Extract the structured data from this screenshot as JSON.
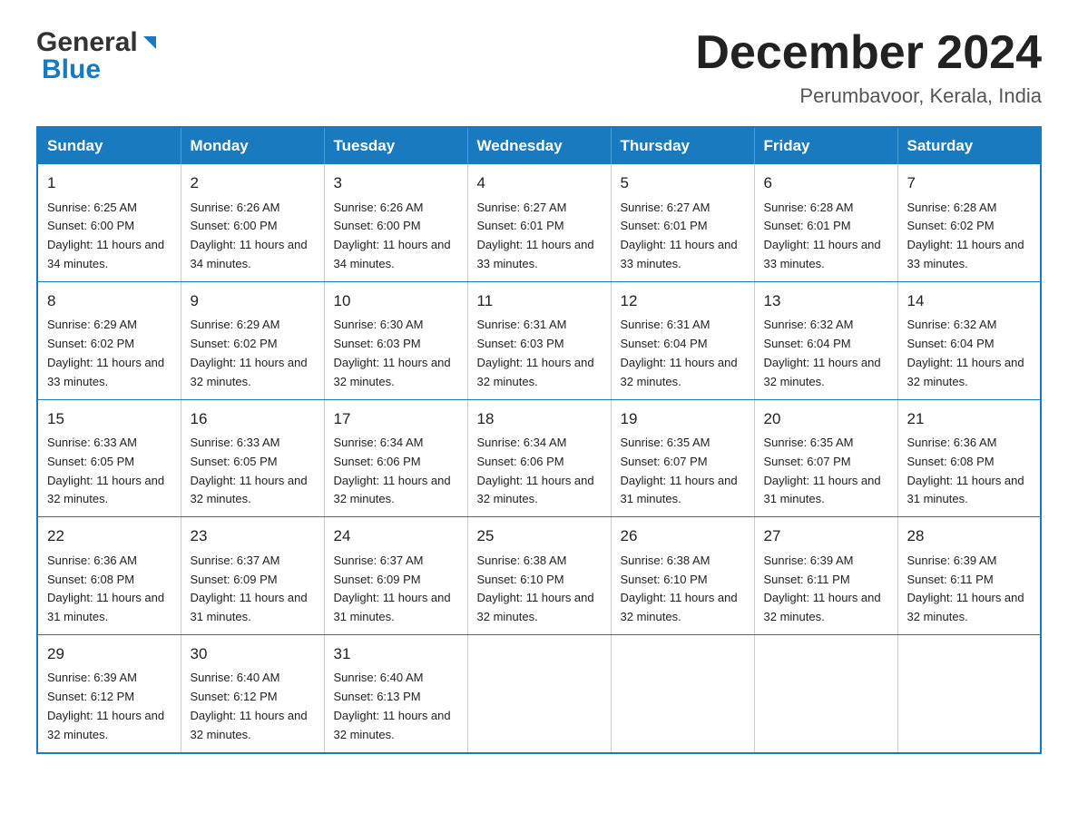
{
  "logo": {
    "general": "General",
    "blue": "Blue"
  },
  "title": "December 2024",
  "location": "Perumbavoor, Kerala, India",
  "days_of_week": [
    "Sunday",
    "Monday",
    "Tuesday",
    "Wednesday",
    "Thursday",
    "Friday",
    "Saturday"
  ],
  "weeks": [
    [
      {
        "day": "1",
        "sunrise": "6:25 AM",
        "sunset": "6:00 PM",
        "daylight": "11 hours and 34 minutes."
      },
      {
        "day": "2",
        "sunrise": "6:26 AM",
        "sunset": "6:00 PM",
        "daylight": "11 hours and 34 minutes."
      },
      {
        "day": "3",
        "sunrise": "6:26 AM",
        "sunset": "6:00 PM",
        "daylight": "11 hours and 34 minutes."
      },
      {
        "day": "4",
        "sunrise": "6:27 AM",
        "sunset": "6:01 PM",
        "daylight": "11 hours and 33 minutes."
      },
      {
        "day": "5",
        "sunrise": "6:27 AM",
        "sunset": "6:01 PM",
        "daylight": "11 hours and 33 minutes."
      },
      {
        "day": "6",
        "sunrise": "6:28 AM",
        "sunset": "6:01 PM",
        "daylight": "11 hours and 33 minutes."
      },
      {
        "day": "7",
        "sunrise": "6:28 AM",
        "sunset": "6:02 PM",
        "daylight": "11 hours and 33 minutes."
      }
    ],
    [
      {
        "day": "8",
        "sunrise": "6:29 AM",
        "sunset": "6:02 PM",
        "daylight": "11 hours and 33 minutes."
      },
      {
        "day": "9",
        "sunrise": "6:29 AM",
        "sunset": "6:02 PM",
        "daylight": "11 hours and 32 minutes."
      },
      {
        "day": "10",
        "sunrise": "6:30 AM",
        "sunset": "6:03 PM",
        "daylight": "11 hours and 32 minutes."
      },
      {
        "day": "11",
        "sunrise": "6:31 AM",
        "sunset": "6:03 PM",
        "daylight": "11 hours and 32 minutes."
      },
      {
        "day": "12",
        "sunrise": "6:31 AM",
        "sunset": "6:04 PM",
        "daylight": "11 hours and 32 minutes."
      },
      {
        "day": "13",
        "sunrise": "6:32 AM",
        "sunset": "6:04 PM",
        "daylight": "11 hours and 32 minutes."
      },
      {
        "day": "14",
        "sunrise": "6:32 AM",
        "sunset": "6:04 PM",
        "daylight": "11 hours and 32 minutes."
      }
    ],
    [
      {
        "day": "15",
        "sunrise": "6:33 AM",
        "sunset": "6:05 PM",
        "daylight": "11 hours and 32 minutes."
      },
      {
        "day": "16",
        "sunrise": "6:33 AM",
        "sunset": "6:05 PM",
        "daylight": "11 hours and 32 minutes."
      },
      {
        "day": "17",
        "sunrise": "6:34 AM",
        "sunset": "6:06 PM",
        "daylight": "11 hours and 32 minutes."
      },
      {
        "day": "18",
        "sunrise": "6:34 AM",
        "sunset": "6:06 PM",
        "daylight": "11 hours and 32 minutes."
      },
      {
        "day": "19",
        "sunrise": "6:35 AM",
        "sunset": "6:07 PM",
        "daylight": "11 hours and 31 minutes."
      },
      {
        "day": "20",
        "sunrise": "6:35 AM",
        "sunset": "6:07 PM",
        "daylight": "11 hours and 31 minutes."
      },
      {
        "day": "21",
        "sunrise": "6:36 AM",
        "sunset": "6:08 PM",
        "daylight": "11 hours and 31 minutes."
      }
    ],
    [
      {
        "day": "22",
        "sunrise": "6:36 AM",
        "sunset": "6:08 PM",
        "daylight": "11 hours and 31 minutes."
      },
      {
        "day": "23",
        "sunrise": "6:37 AM",
        "sunset": "6:09 PM",
        "daylight": "11 hours and 31 minutes."
      },
      {
        "day": "24",
        "sunrise": "6:37 AM",
        "sunset": "6:09 PM",
        "daylight": "11 hours and 31 minutes."
      },
      {
        "day": "25",
        "sunrise": "6:38 AM",
        "sunset": "6:10 PM",
        "daylight": "11 hours and 32 minutes."
      },
      {
        "day": "26",
        "sunrise": "6:38 AM",
        "sunset": "6:10 PM",
        "daylight": "11 hours and 32 minutes."
      },
      {
        "day": "27",
        "sunrise": "6:39 AM",
        "sunset": "6:11 PM",
        "daylight": "11 hours and 32 minutes."
      },
      {
        "day": "28",
        "sunrise": "6:39 AM",
        "sunset": "6:11 PM",
        "daylight": "11 hours and 32 minutes."
      }
    ],
    [
      {
        "day": "29",
        "sunrise": "6:39 AM",
        "sunset": "6:12 PM",
        "daylight": "11 hours and 32 minutes."
      },
      {
        "day": "30",
        "sunrise": "6:40 AM",
        "sunset": "6:12 PM",
        "daylight": "11 hours and 32 minutes."
      },
      {
        "day": "31",
        "sunrise": "6:40 AM",
        "sunset": "6:13 PM",
        "daylight": "11 hours and 32 minutes."
      },
      null,
      null,
      null,
      null
    ]
  ],
  "labels": {
    "sunrise": "Sunrise:",
    "sunset": "Sunset:",
    "daylight": "Daylight:"
  },
  "colors": {
    "header_bg": "#1a7abf",
    "header_text": "#ffffff",
    "border": "#1a7abf"
  }
}
